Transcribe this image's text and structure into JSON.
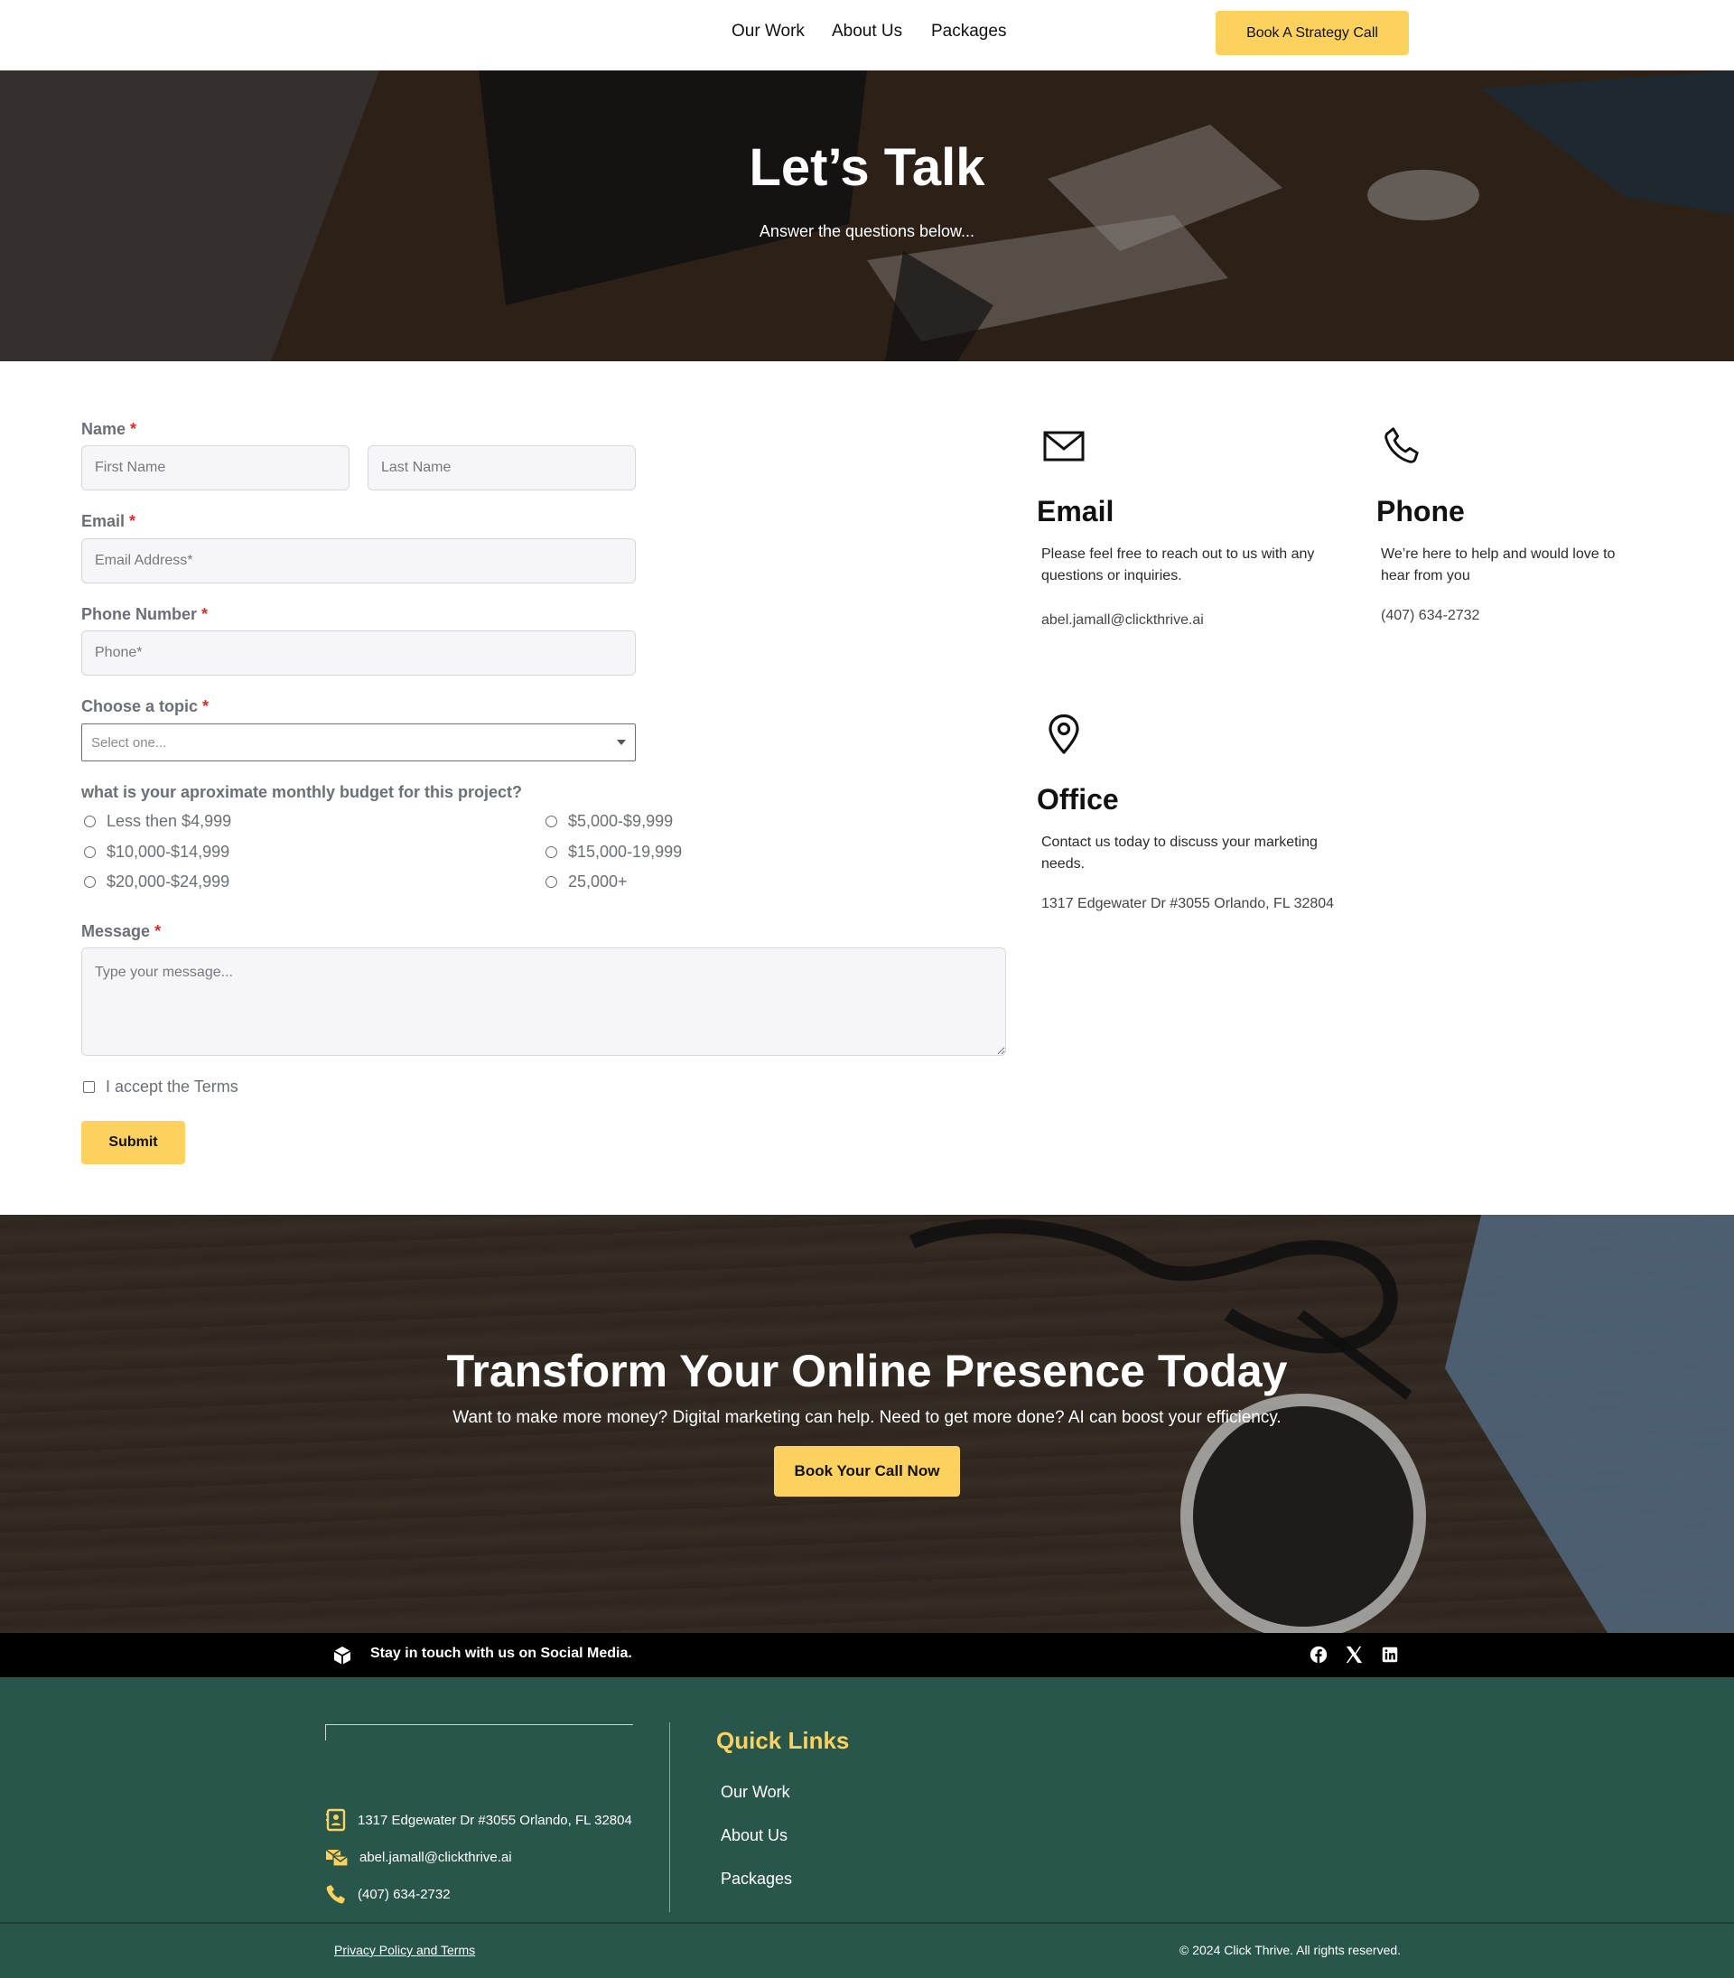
{
  "header": {
    "nav": [
      "Our Work",
      "About Us",
      "Packages"
    ],
    "cta": "Book A Strategy Call"
  },
  "hero": {
    "title": "Let’s Talk",
    "subtitle": "Answer the questions below..."
  },
  "form": {
    "name_label": "Name",
    "first_placeholder": "First Name",
    "last_placeholder": "Last Name",
    "email_label": "Email",
    "email_placeholder": "Email Address*",
    "phone_label": "Phone Number",
    "phone_placeholder": "Phone*",
    "topic_label": "Choose a topic",
    "topic_value": "Select one...",
    "budget_label": "what is your aproximate monthly budget for this project?",
    "budget_options": [
      "Less then $4,999",
      "$5,000-$9,999",
      "$10,000-$14,999",
      "$15,000-19,999",
      "$20,000-$24,999",
      "25,000+"
    ],
    "message_label": "Message",
    "message_placeholder": "Type your message...",
    "terms_label": "I accept the Terms",
    "submit_label": "Submit",
    "required_mark": "*"
  },
  "contact": {
    "email": {
      "title": "Email",
      "text": "Please feel free to reach out to us with any questions or inquiries.",
      "value": "abel.jamall@clickthrive.ai"
    },
    "phone": {
      "title": "Phone",
      "text": "We’re here to help and would love to hear from you",
      "value": "(407) 634-2732"
    },
    "office": {
      "title": "Office",
      "text": "Contact us today to discuss your marketing needs.",
      "value": "1317 Edgewater Dr #3055 Orlando, FL 32804"
    }
  },
  "cta": {
    "title": "Transform Your Online Presence Today",
    "text": "Want to make more money? Digital marketing can help. Need to get more done? AI can boost your efficiency.",
    "button": "Book Your Call Now"
  },
  "social": {
    "text": "Stay in touch with us on Social Media.",
    "icons": [
      "facebook-icon",
      "x-icon",
      "linkedin-icon"
    ]
  },
  "footer": {
    "address": "1317 Edgewater Dr #3055 Orlando, FL 32804",
    "email": "abel.jamall@clickthrive.ai",
    "phone": "(407) 634-2732",
    "quick_links_title": "Quick Links",
    "quick_links": [
      "Our Work",
      "About Us",
      "Packages"
    ],
    "privacy": "Privacy Policy and Terms",
    "copyright": "© 2024 Click Thrive. All rights reserved."
  },
  "colors": {
    "accent": "#fcd15e",
    "footer": "#29564a",
    "required": "#e02b2b"
  }
}
